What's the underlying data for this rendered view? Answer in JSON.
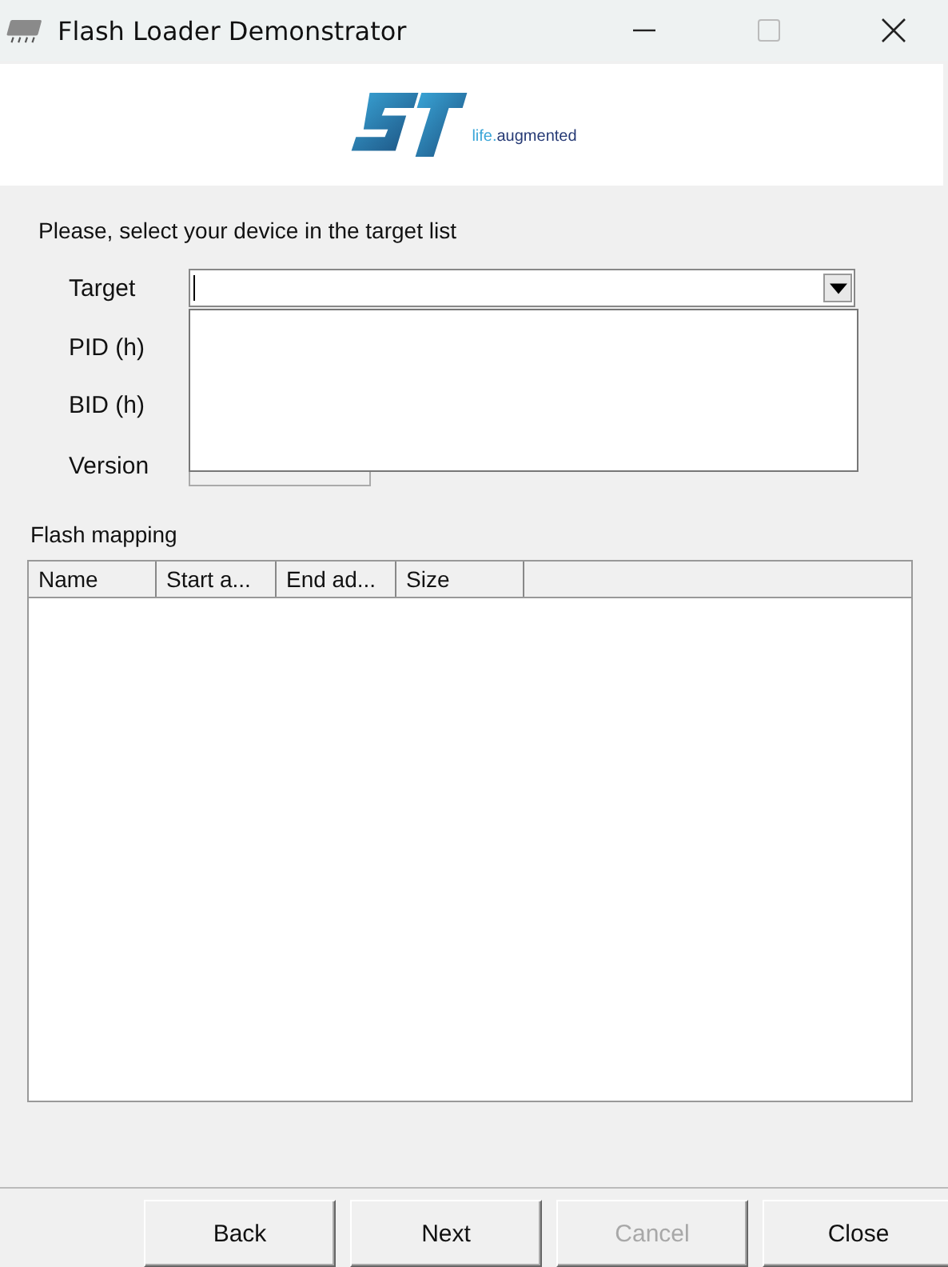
{
  "window": {
    "title": "Flash Loader Demonstrator"
  },
  "logo": {
    "tagline_highlight": "life.",
    "tagline": "augmented"
  },
  "instruction": "Please, select your device in the target list",
  "fields": [
    {
      "label": "Target",
      "kind": "combo"
    },
    {
      "label": "PID  (h)",
      "kind": "covered"
    },
    {
      "label": "BID  (h)",
      "kind": "covered"
    },
    {
      "label": "Version",
      "kind": "short"
    }
  ],
  "target_dropdown": {
    "expanded": true
  },
  "flash_mapping": {
    "title": "Flash mapping",
    "columns": [
      "Name",
      "Start a...",
      "End ad...",
      "Size"
    ]
  },
  "buttons": [
    {
      "label": "Back",
      "disabled": false
    },
    {
      "label": "Next",
      "disabled": false
    },
    {
      "label": "Cancel",
      "disabled": true
    },
    {
      "label": "Close",
      "disabled": false
    }
  ]
}
